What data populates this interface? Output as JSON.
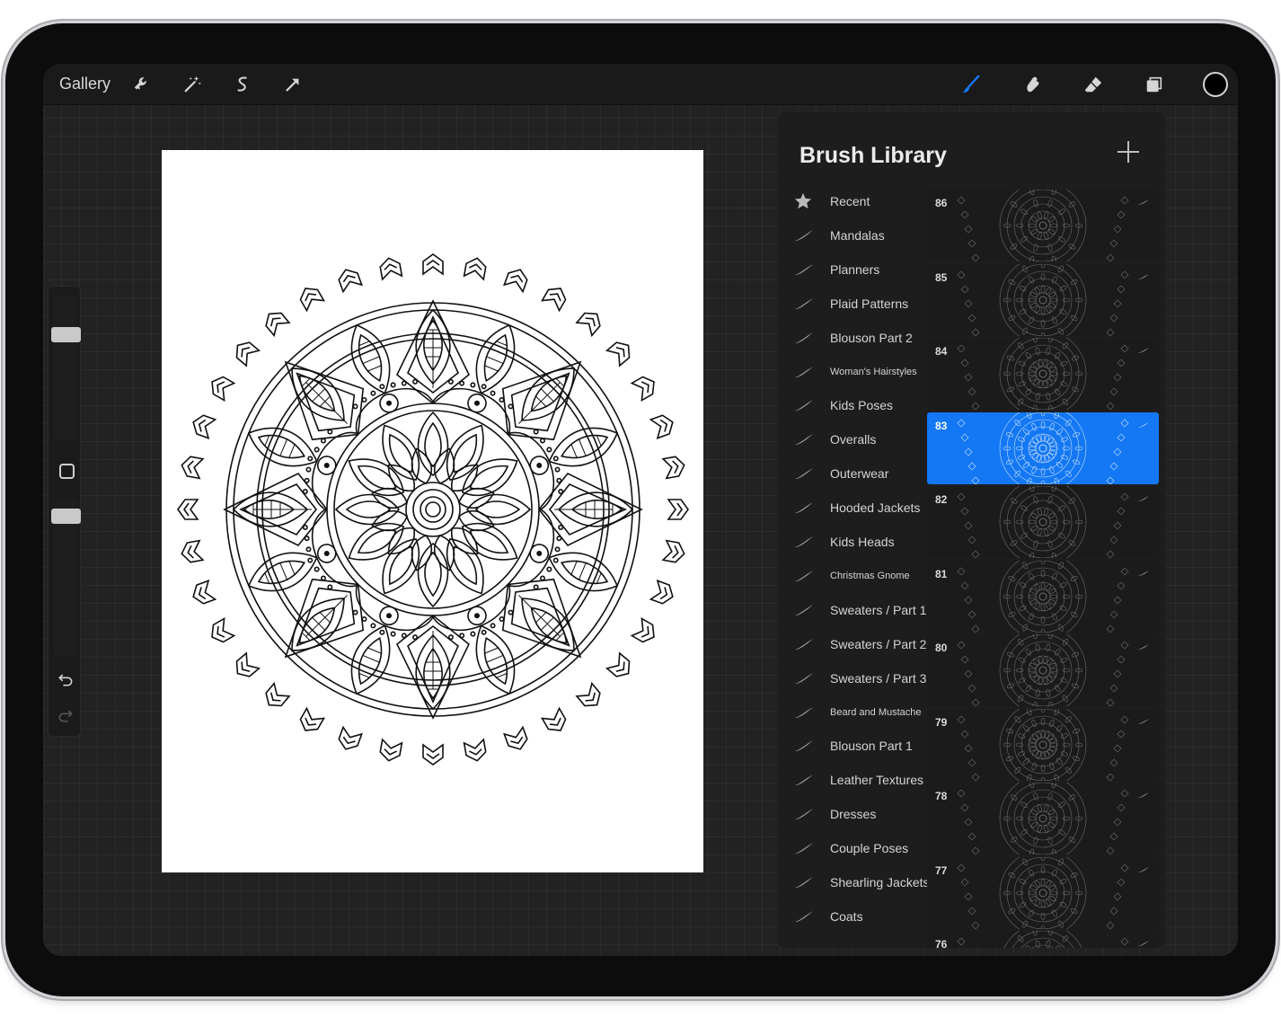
{
  "toolbar": {
    "gallery_label": "Gallery",
    "left_tools": [
      "wrench-icon",
      "magic-wand-icon",
      "selection-icon",
      "transform-arrow-icon"
    ],
    "right_tools": [
      "brush-icon",
      "smudge-icon",
      "eraser-icon",
      "layers-icon",
      "color-icon"
    ],
    "active_tool_color": "#1478f5",
    "current_color": "#000000"
  },
  "sidebar": {
    "brush_size_level": 0.25,
    "opacity_level": 0.3,
    "buttons": [
      "modify-square-icon",
      "undo-icon",
      "redo-icon"
    ]
  },
  "brush_library": {
    "title": "Brush Library",
    "categories": [
      {
        "label": "Recent",
        "icon": "star-icon"
      },
      {
        "label": "Mandalas",
        "icon": "brush-stroke-icon"
      },
      {
        "label": "Planners",
        "icon": "brush-stroke-icon"
      },
      {
        "label": "Plaid Patterns",
        "icon": "brush-stroke-icon"
      },
      {
        "label": "Blouson Part 2",
        "icon": "brush-stroke-icon"
      },
      {
        "label": "Woman's Hairstyles",
        "icon": "brush-stroke-icon",
        "small": true
      },
      {
        "label": "Kids Poses",
        "icon": "brush-stroke-icon"
      },
      {
        "label": "Overalls",
        "icon": "brush-stroke-icon"
      },
      {
        "label": "Outerwear",
        "icon": "brush-stroke-icon"
      },
      {
        "label": "Hooded Jackets",
        "icon": "brush-stroke-icon"
      },
      {
        "label": "Kids Heads",
        "icon": "brush-stroke-icon"
      },
      {
        "label": "Christmas Gnome",
        "icon": "brush-stroke-icon",
        "small": true
      },
      {
        "label": "Sweaters / Part 1",
        "icon": "brush-stroke-icon"
      },
      {
        "label": "Sweaters / Part 2",
        "icon": "brush-stroke-icon"
      },
      {
        "label": "Sweaters / Part 3",
        "icon": "brush-stroke-icon"
      },
      {
        "label": "Beard and Mustache",
        "icon": "brush-stroke-icon",
        "small": true
      },
      {
        "label": "Blouson Part 1",
        "icon": "brush-stroke-icon"
      },
      {
        "label": "Leather Textures",
        "icon": "brush-stroke-icon"
      },
      {
        "label": "Dresses",
        "icon": "brush-stroke-icon"
      },
      {
        "label": "Couple Poses",
        "icon": "brush-stroke-icon"
      },
      {
        "label": "Shearling Jackets",
        "icon": "brush-stroke-icon"
      },
      {
        "label": "Coats",
        "icon": "brush-stroke-icon"
      }
    ],
    "brushes": [
      {
        "number": "86",
        "selected": false
      },
      {
        "number": "85",
        "selected": false
      },
      {
        "number": "84",
        "selected": false
      },
      {
        "number": "83",
        "selected": true
      },
      {
        "number": "82",
        "selected": false
      },
      {
        "number": "81",
        "selected": false
      },
      {
        "number": "80",
        "selected": false
      },
      {
        "number": "79",
        "selected": false
      },
      {
        "number": "78",
        "selected": false
      },
      {
        "number": "77",
        "selected": false
      },
      {
        "number": "76",
        "selected": false
      }
    ],
    "selected_color": "#1478f5"
  }
}
